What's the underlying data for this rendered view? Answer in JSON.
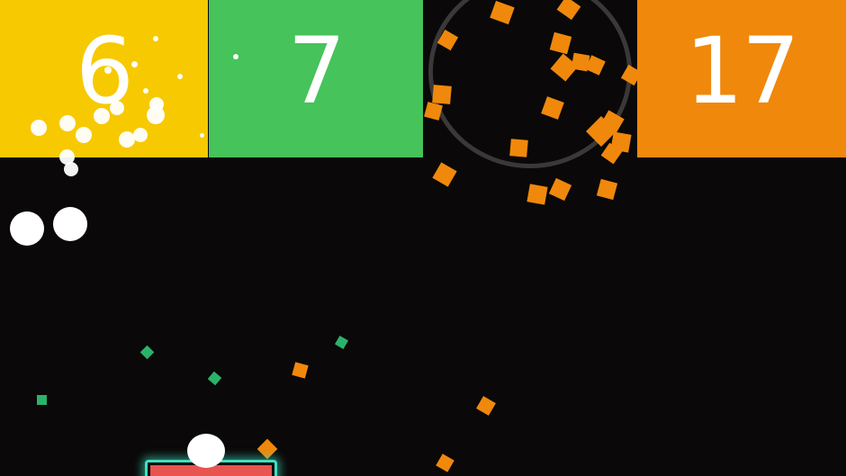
{
  "blocks": {
    "yellow": {
      "value": "6",
      "color": "#f7c900"
    },
    "green": {
      "value": "7",
      "color": "#46c35a"
    },
    "orange": {
      "value": "17",
      "color": "#f0880c"
    }
  },
  "colors": {
    "background": "#0a0808",
    "ring": "#3a3838",
    "shard_orange": "#f0880c",
    "shard_green": "#2bb26a",
    "paddle_fill": "#e8544f",
    "paddle_glow": "#3fe0c0",
    "ball": "#ffffff"
  },
  "icons": {
    "ring": "explosion-ring-icon",
    "ball": "ball-icon",
    "paddle": "paddle-icon"
  }
}
